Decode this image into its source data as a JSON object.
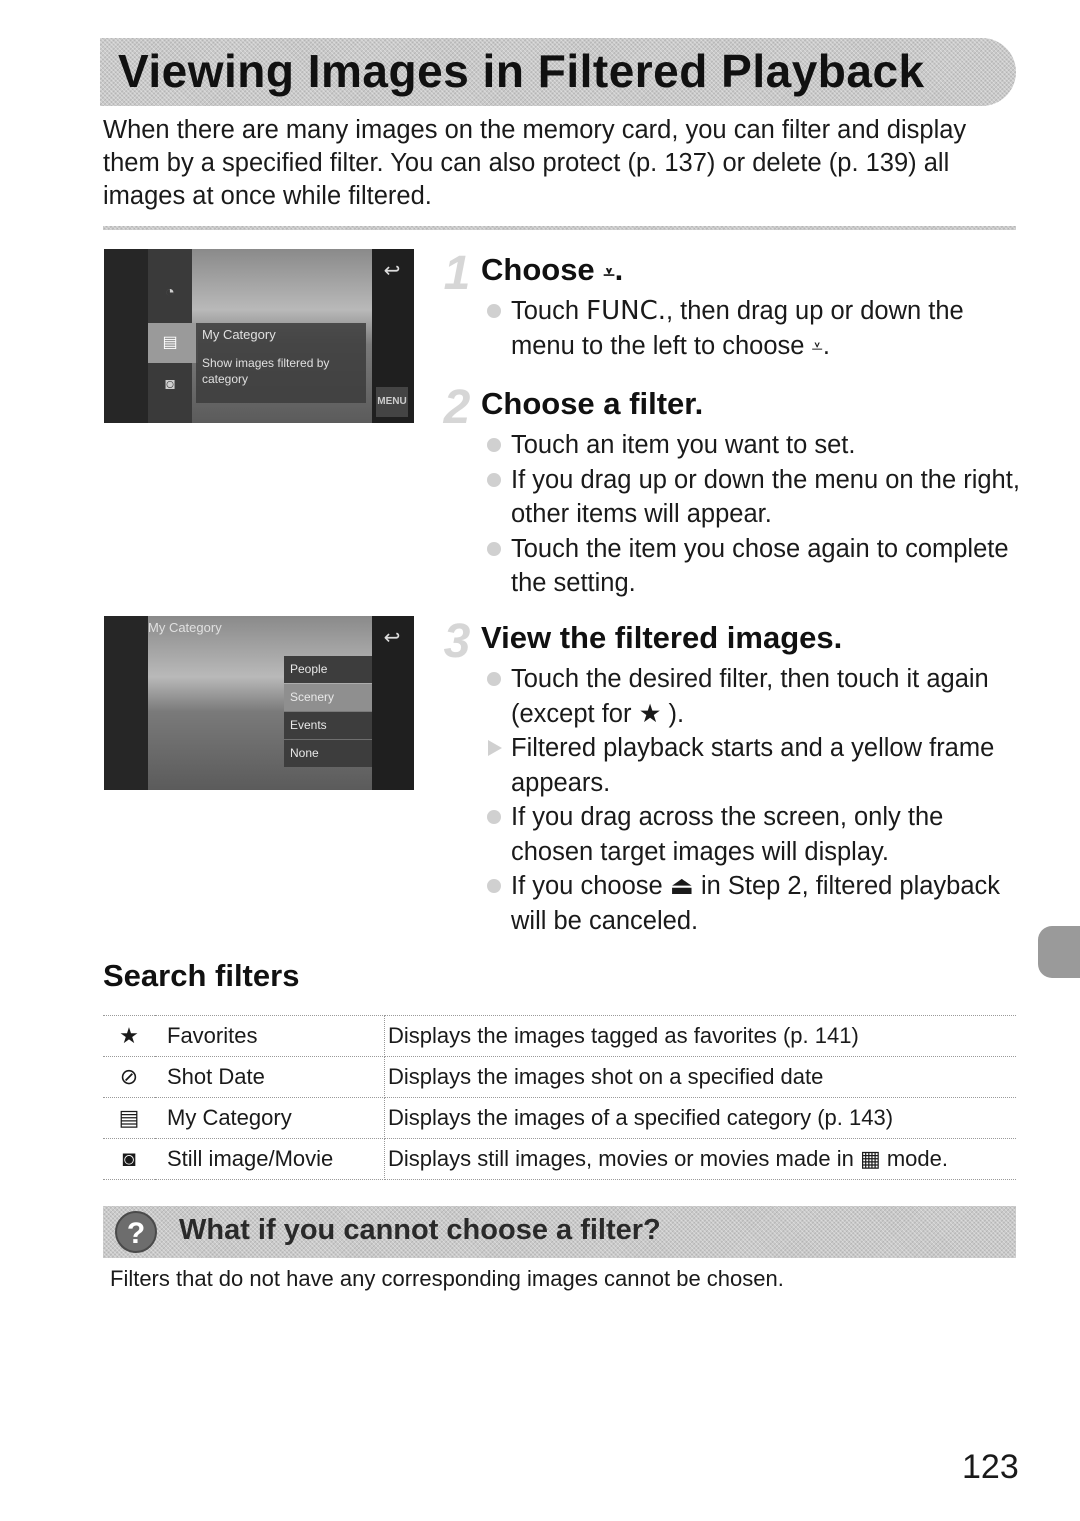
{
  "page": {
    "title": "Viewing Images in Filtered Playback",
    "intro": "When there are many images on the memory card, you can filter and display them by a specified filter. You can also protect (p. 137) or delete (p. 139) all images at once while filtered.",
    "page_number": "123"
  },
  "screens": {
    "screen1": {
      "panel_title": "My Category",
      "panel_desc": "Show images filtered by category",
      "back_icon": "↩",
      "menu_label": "MENU"
    },
    "screen2": {
      "header": "My Category",
      "back_icon": "↩",
      "options": [
        "People",
        "Scenery",
        "Events",
        "None"
      ],
      "selected": "Scenery"
    }
  },
  "steps": [
    {
      "number": "1",
      "title_prefix": "Choose",
      "title_icon": "⩡",
      "title_suffix": ".",
      "bullets": [
        {
          "pre": "Touch ",
          "func": "FUNC.",
          "post": ", then drag up or down the menu to the left to choose ",
          "icon": "⩡",
          "end": "."
        }
      ]
    },
    {
      "number": "2",
      "title": "Choose a filter.",
      "bullets": [
        "Touch an item you want to set.",
        "If you drag up or down the menu on the right, other items will appear.",
        "Touch the item you chose again to complete the setting."
      ]
    },
    {
      "number": "3",
      "title": "View the filtered images.",
      "bullets": [
        {
          "type": "circle",
          "pre": "Touch the desired filter, then touch it again (except for ",
          "icon": "★",
          "post": " )."
        },
        {
          "type": "arrow",
          "text": "Filtered playback starts and a yellow frame appears."
        },
        {
          "type": "circle",
          "text": "If you drag across the screen, only the chosen target images will display."
        },
        {
          "type": "circle",
          "pre": "If you choose ",
          "icon": "⏏",
          "post": " in Step 2, filtered playback will be canceled."
        }
      ]
    }
  ],
  "search_filters": {
    "title": "Search filters",
    "rows": [
      {
        "icon": "★",
        "icon_name": "star-icon",
        "name": "Favorites",
        "description": "Displays the images tagged as favorites (p. 141)"
      },
      {
        "icon": "⊘",
        "icon_name": "clock-check-icon",
        "name": "Shot Date",
        "description": "Displays the images shot on a specified date"
      },
      {
        "icon": "▤",
        "icon_name": "category-icon",
        "name": "My Category",
        "description": "Displays the images of a specified category (p. 143)"
      },
      {
        "icon": "◙",
        "icon_name": "still-movie-icon",
        "name": "Still image/Movie",
        "description_pre": "Displays still images, movies or movies made in ",
        "description_icon": "▦",
        "description_post": " mode."
      }
    ]
  },
  "tip": {
    "icon": "?",
    "title": "What if you cannot choose a filter?",
    "text": "Filters that do not have any corresponding images cannot be chosen."
  }
}
